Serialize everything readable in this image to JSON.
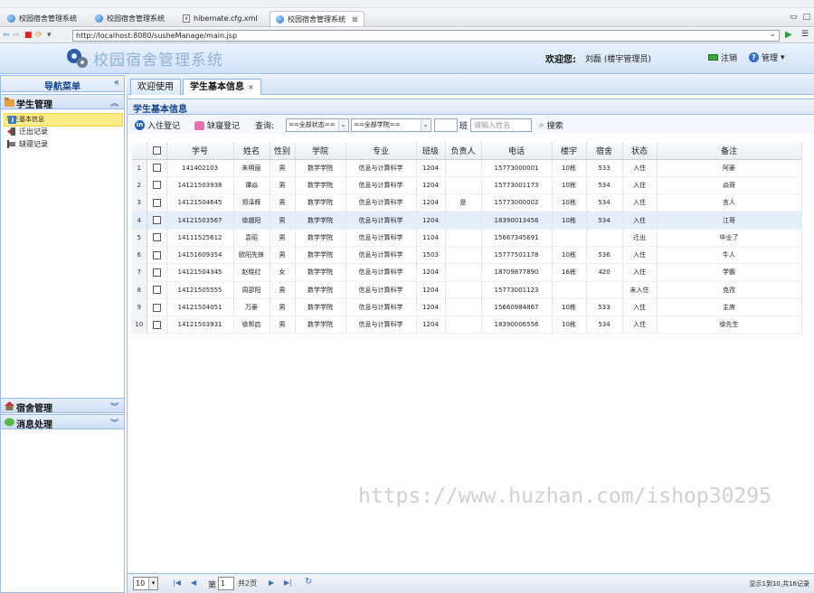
{
  "browser": {
    "tabs": [
      {
        "label": "校园宿舍管理系统",
        "icon": "globe-icon"
      },
      {
        "label": "校园宿舍管理系统",
        "icon": "globe-icon"
      },
      {
        "label": "hibernate.cfg.xml",
        "icon": "xml-file-icon"
      },
      {
        "label": "校园宿舍管理系统",
        "icon": "globe-icon",
        "active": true
      }
    ],
    "url": "http://localhost:8080/susheManage/main.jsp"
  },
  "header": {
    "title": "校园宿舍管理系统",
    "welcome_label": "欢迎您:",
    "user": "刘磊 (楼宇管理员)",
    "logout": "注销",
    "manage": "管理"
  },
  "west": {
    "title": "导航菜单",
    "sections": [
      {
        "title": "学生管理",
        "items": [
          "学生基本信息",
          "迁出记录",
          "缺寝记录"
        ]
      },
      {
        "title": "宿舍管理"
      },
      {
        "title": "消息处理"
      }
    ]
  },
  "center": {
    "tabs": [
      {
        "label": "欢迎使用"
      },
      {
        "label": "学生基本信息",
        "close": "×"
      }
    ],
    "panel_title": "学生基本信息",
    "toolbar": {
      "checkin": "入住登记",
      "absent": "缺寝登记",
      "query": "查询:",
      "status_select": "==全部状态==",
      "college_select": "==全部学院==",
      "class_suffix": "班",
      "name_placeholder": "请输入姓名",
      "search": "搜索"
    },
    "columns": [
      "学号",
      "姓名",
      "性别",
      "学院",
      "专业",
      "班级",
      "负责人",
      "电话",
      "楼宇",
      "宿舍",
      "状态",
      "备注"
    ],
    "rows": [
      [
        "141402103",
        "朱明丽",
        "男",
        "数学学院",
        "信息与计算科学",
        "1204",
        "",
        "15773000001",
        "10栋",
        "533",
        "入住",
        "阿豪"
      ],
      [
        "14121503938",
        "谭焱",
        "男",
        "数学学院",
        "信息与计算科学",
        "1204",
        "",
        "15773001173",
        "10栋",
        "534",
        "入住",
        "焱哥"
      ],
      [
        "14121504645",
        "郑泽辉",
        "男",
        "数学学院",
        "信息与计算科学",
        "1204",
        "是",
        "15773000002",
        "10栋",
        "534",
        "入住",
        "言人"
      ],
      [
        "14121503567",
        "徐翘阳",
        "男",
        "数学学院",
        "信息与计算科学",
        "1204",
        "",
        "18390013456",
        "10栋",
        "534",
        "入住",
        "江哥"
      ],
      [
        "14111525612",
        "袁昭",
        "男",
        "数学学院",
        "信息与计算科学",
        "1104",
        "",
        "15667345691",
        "",
        "",
        "迁出",
        "毕业了"
      ],
      [
        "14151609354",
        "欧阳先锋",
        "男",
        "数学学院",
        "信息与计算科学",
        "1503",
        "",
        "15777501178",
        "10栋",
        "536",
        "入住",
        "牛人"
      ],
      [
        "14121504345",
        "赵晓红",
        "女",
        "数学学院",
        "信息与计算科学",
        "1204",
        "",
        "18709877890",
        "16栋",
        "420",
        "入住",
        "学霸"
      ],
      [
        "14121505555",
        "周邵阳",
        "男",
        "数学学院",
        "信息与计算科学",
        "1204",
        "",
        "15773001123",
        "",
        "",
        "未入住",
        "克孜"
      ],
      [
        "14121504051",
        "万豪",
        "男",
        "数学学院",
        "信息与计算科学",
        "1204",
        "",
        "15660984867",
        "10栋",
        "533",
        "入住",
        "主席"
      ],
      [
        "14121503931",
        "徐邦启",
        "男",
        "数学学院",
        "信息与计算科学",
        "1204",
        "",
        "18390006556",
        "10栋",
        "534",
        "入住",
        "徐先生"
      ]
    ],
    "highlight_row": 4,
    "pager": {
      "page_size": "10",
      "page_label": "第",
      "current_page": "1",
      "total_pages": "共2页",
      "info": "显示1到10,共16记录"
    }
  },
  "watermark": "https://www.huzhan.com/ishop30295"
}
